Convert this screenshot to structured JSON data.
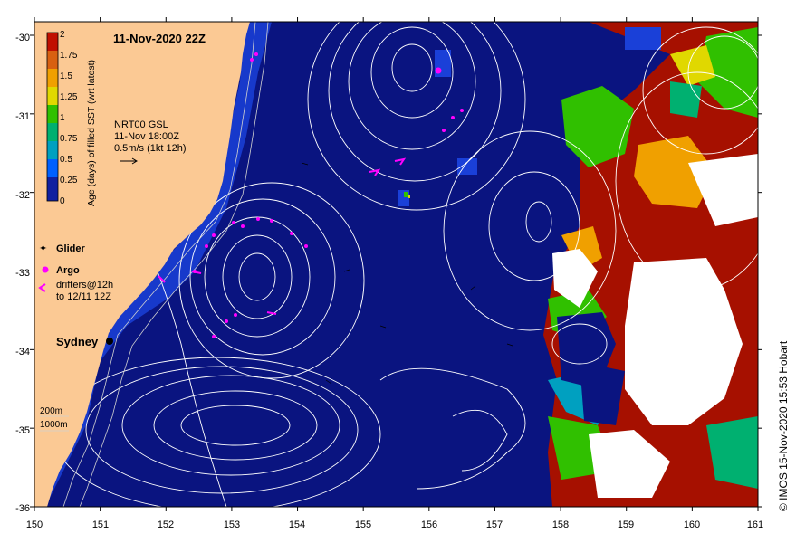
{
  "title": "11-Nov-2020 22Z",
  "credit": "© IMOS 15-Nov-2020 15:53 Hobart",
  "colorbar": {
    "label": "Age (days) of filled SST (wrt latest)",
    "ticks": [
      "2",
      "1.75",
      "1.5",
      "1.25",
      "1",
      "0.75",
      "0.5",
      "0.25",
      "0"
    ],
    "colors": [
      "#c01000",
      "#d86010",
      "#f0a000",
      "#e0d800",
      "#30c000",
      "#00b070",
      "#00a0c0",
      "#0060ff",
      "#1020a0",
      "#0a1480"
    ]
  },
  "current_info": {
    "line1": "NRT00 GSL",
    "line2": "11-Nov 18:00Z",
    "line3": "0.5m/s (1kt 12h)"
  },
  "legend": {
    "glider": "Glider",
    "argo": "Argo",
    "drifters1": "drifters@12h",
    "drifters2": "to 12/11 12Z"
  },
  "place": {
    "sydney": "Sydney"
  },
  "bathy": {
    "depth1": "200m",
    "depth2": "1000m"
  },
  "axes": {
    "x_ticks": [
      "150",
      "151",
      "152",
      "153",
      "154",
      "155",
      "156",
      "157",
      "158",
      "159",
      "160",
      "161"
    ],
    "y_ticks": [
      "-30",
      "-31",
      "-32",
      "-33",
      "-34",
      "-35",
      "-36"
    ]
  },
  "colors": {
    "land": "#fbc994",
    "ocean_deep": "#0a1480",
    "ocean_mid": "#1a40d8",
    "warm_red": "#a61000",
    "contour": "#ffffff",
    "marker": "#ff00ff"
  }
}
